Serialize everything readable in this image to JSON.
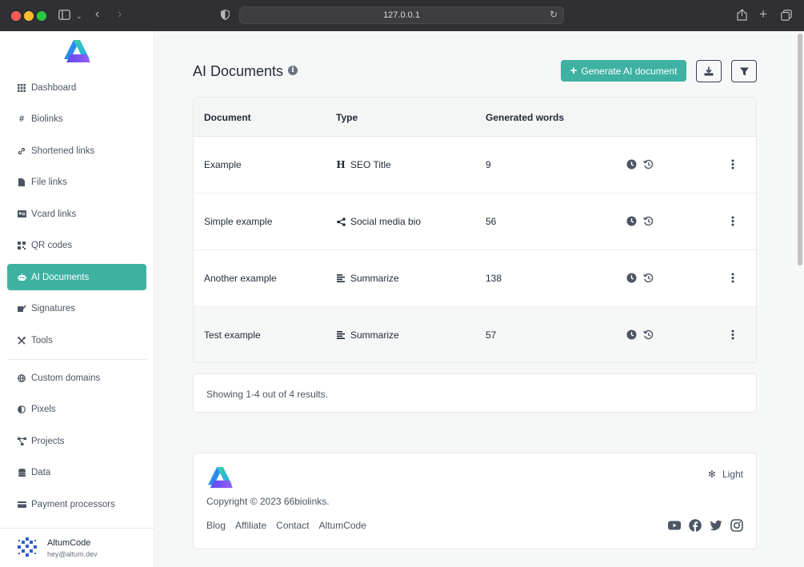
{
  "browser": {
    "url": "127.0.0.1"
  },
  "sidebar": {
    "items": [
      {
        "label": "Dashboard",
        "icon": "grid-icon"
      },
      {
        "label": "Biolinks",
        "icon": "hashtag-icon"
      },
      {
        "label": "Shortened links",
        "icon": "link-icon"
      },
      {
        "label": "File links",
        "icon": "file-icon"
      },
      {
        "label": "Vcard links",
        "icon": "id-card-icon"
      },
      {
        "label": "QR codes",
        "icon": "qrcode-icon"
      },
      {
        "label": "AI Documents",
        "icon": "robot-icon",
        "active": true
      },
      {
        "label": "Signatures",
        "icon": "signature-icon"
      },
      {
        "label": "Tools",
        "icon": "tools-icon"
      }
    ],
    "items2": [
      {
        "label": "Custom domains",
        "icon": "globe-icon"
      },
      {
        "label": "Pixels",
        "icon": "adjust-icon"
      },
      {
        "label": "Projects",
        "icon": "project-diagram-icon"
      },
      {
        "label": "Data",
        "icon": "database-icon"
      },
      {
        "label": "Payment processors",
        "icon": "credit-card-icon"
      }
    ],
    "user": {
      "name": "AltumCode",
      "email": "hey@altum.dev"
    }
  },
  "main": {
    "title": "AI Documents",
    "generate_label": "Generate AI document",
    "table": {
      "headers": [
        "Document",
        "Type",
        "Generated words"
      ],
      "rows": [
        {
          "document": "Example",
          "type": "SEO Title",
          "type_icon": "heading-icon",
          "words": "9"
        },
        {
          "document": "Simple example",
          "type": "Social media bio",
          "type_icon": "share-icon",
          "words": "56"
        },
        {
          "document": "Another example",
          "type": "Summarize",
          "type_icon": "align-left-icon",
          "words": "138"
        },
        {
          "document": "Test example",
          "type": "Summarize",
          "type_icon": "align-left-icon",
          "words": "57"
        }
      ]
    },
    "pagination_text": "Showing 1-4 out of 4 results."
  },
  "footer": {
    "theme_label": "Light",
    "copyright": "Copyright © 2023 66biolinks.",
    "links": [
      "Blog",
      "Affiliate",
      "Contact",
      "AltumCode"
    ]
  },
  "colors": {
    "accent": "#3eb1a2",
    "text": "#1f2937",
    "muted": "#4b5563"
  }
}
